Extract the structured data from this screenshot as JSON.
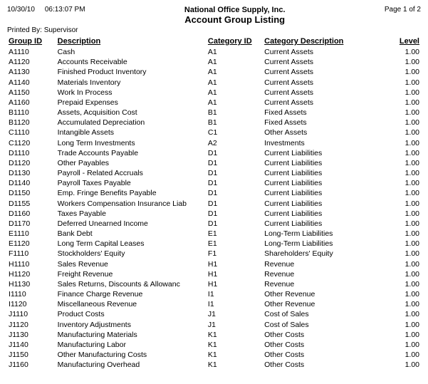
{
  "header": {
    "date": "10/30/10",
    "time": "06:13:07 PM",
    "company": "National Office Supply, Inc.",
    "page": "Page 1 of 2",
    "printed_by": "Printed By: Supervisor",
    "title": "Account Group Listing"
  },
  "columns": {
    "group_id": "Group ID",
    "description": "Description",
    "category_id": "Category ID",
    "category_description": "Category Description",
    "level": "Level"
  },
  "rows": [
    {
      "group_id": "A1110",
      "description": "Cash",
      "category_id": "A1",
      "category_description": "Current Assets",
      "level": "1.00"
    },
    {
      "group_id": "A1120",
      "description": "Accounts Receivable",
      "category_id": "A1",
      "category_description": "Current Assets",
      "level": "1.00"
    },
    {
      "group_id": "A1130",
      "description": "Finished Product Inventory",
      "category_id": "A1",
      "category_description": "Current Assets",
      "level": "1.00"
    },
    {
      "group_id": "A1140",
      "description": "Materials Inventory",
      "category_id": "A1",
      "category_description": "Current Assets",
      "level": "1.00"
    },
    {
      "group_id": "A1150",
      "description": "Work In Process",
      "category_id": "A1",
      "category_description": "Current Assets",
      "level": "1.00"
    },
    {
      "group_id": "A1160",
      "description": "Prepaid Expenses",
      "category_id": "A1",
      "category_description": "Current Assets",
      "level": "1.00"
    },
    {
      "group_id": "B1110",
      "description": "Assets, Acquisition Cost",
      "category_id": "B1",
      "category_description": "Fixed Assets",
      "level": "1.00"
    },
    {
      "group_id": "B1120",
      "description": "Accumulated Depreciation",
      "category_id": "B1",
      "category_description": "Fixed Assets",
      "level": "1.00"
    },
    {
      "group_id": "C1110",
      "description": "Intangible Assets",
      "category_id": "C1",
      "category_description": "Other Assets",
      "level": "1.00"
    },
    {
      "group_id": "C1120",
      "description": "Long Term Investments",
      "category_id": "A2",
      "category_description": "Investments",
      "level": "1.00"
    },
    {
      "group_id": "D1110",
      "description": "Trade Accounts Payable",
      "category_id": "D1",
      "category_description": "Current Liabilities",
      "level": "1.00"
    },
    {
      "group_id": "D1120",
      "description": "Other Payables",
      "category_id": "D1",
      "category_description": "Current Liabilities",
      "level": "1.00"
    },
    {
      "group_id": "D1130",
      "description": "Payroll - Related Accruals",
      "category_id": "D1",
      "category_description": "Current Liabilities",
      "level": "1.00"
    },
    {
      "group_id": "D1140",
      "description": "Payroll Taxes Payable",
      "category_id": "D1",
      "category_description": "Current Liabilities",
      "level": "1.00"
    },
    {
      "group_id": "D1150",
      "description": "Emp. Fringe Benefits Payable",
      "category_id": "D1",
      "category_description": "Current Liabilities",
      "level": "1.00"
    },
    {
      "group_id": "D1155",
      "description": "Workers Compensation Insurance Liab",
      "category_id": "D1",
      "category_description": "Current Liabilities",
      "level": "1.00"
    },
    {
      "group_id": "D1160",
      "description": "Taxes Payable",
      "category_id": "D1",
      "category_description": "Current Liabilities",
      "level": "1.00"
    },
    {
      "group_id": "D1170",
      "description": "Deferred Unearned Income",
      "category_id": "D1",
      "category_description": "Current Liabilities",
      "level": "1.00"
    },
    {
      "group_id": "E1110",
      "description": "Bank Debt",
      "category_id": "E1",
      "category_description": "Long-Term Liabilities",
      "level": "1.00"
    },
    {
      "group_id": "E1120",
      "description": "Long Term Capital Leases",
      "category_id": "E1",
      "category_description": "Long-Term Liabilities",
      "level": "1.00"
    },
    {
      "group_id": "F1110",
      "description": "Stockholders' Equity",
      "category_id": "F1",
      "category_description": "Shareholders' Equity",
      "level": "1.00"
    },
    {
      "group_id": "H1110",
      "description": "Sales Revenue",
      "category_id": "H1",
      "category_description": "Revenue",
      "level": "1.00"
    },
    {
      "group_id": "H1120",
      "description": "Freight Revenue",
      "category_id": "H1",
      "category_description": "Revenue",
      "level": "1.00"
    },
    {
      "group_id": "H1130",
      "description": "Sales Returns, Discounts & Allowanc",
      "category_id": "H1",
      "category_description": "Revenue",
      "level": "1.00"
    },
    {
      "group_id": "I1110",
      "description": "Finance Charge Revenue",
      "category_id": "I1",
      "category_description": "Other Revenue",
      "level": "1.00"
    },
    {
      "group_id": "I1120",
      "description": "Miscellaneous Revenue",
      "category_id": "I1",
      "category_description": "Other Revenue",
      "level": "1.00"
    },
    {
      "group_id": "J1110",
      "description": "Product Costs",
      "category_id": "J1",
      "category_description": "Cost of Sales",
      "level": "1.00"
    },
    {
      "group_id": "J1120",
      "description": "Inventory Adjustments",
      "category_id": "J1",
      "category_description": "Cost of Sales",
      "level": "1.00"
    },
    {
      "group_id": "J1130",
      "description": "Manufacturing Materials",
      "category_id": "K1",
      "category_description": "Other Costs",
      "level": "1.00"
    },
    {
      "group_id": "J1140",
      "description": "Manufacturing Labor",
      "category_id": "K1",
      "category_description": "Other Costs",
      "level": "1.00"
    },
    {
      "group_id": "J1150",
      "description": "Other Manufacturing Costs",
      "category_id": "K1",
      "category_description": "Other Costs",
      "level": "1.00"
    },
    {
      "group_id": "J1160",
      "description": "Manufacturing Overhead",
      "category_id": "K1",
      "category_description": "Other Costs",
      "level": "1.00"
    }
  ]
}
